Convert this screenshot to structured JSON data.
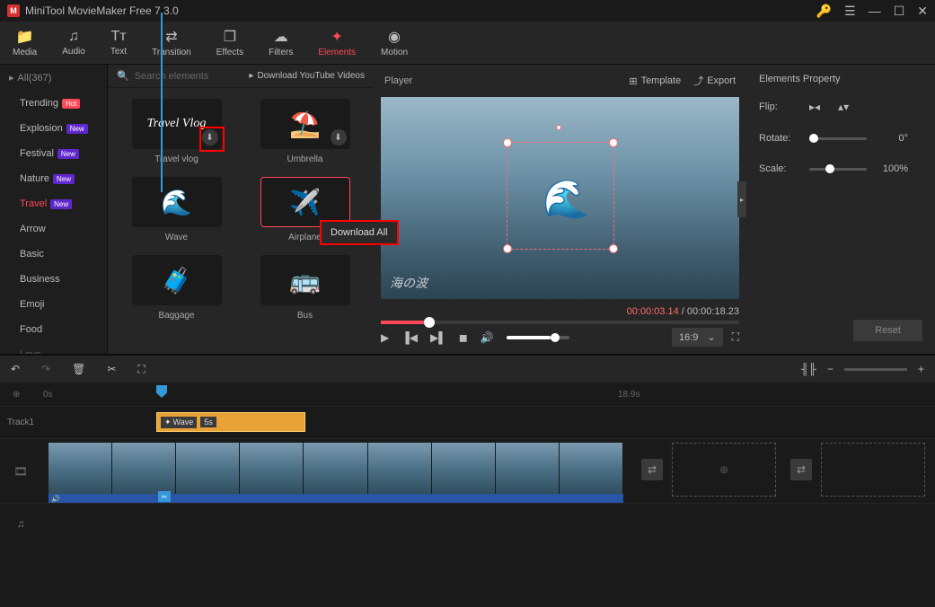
{
  "app": {
    "title": "MiniTool MovieMaker Free 7.3.0"
  },
  "toolbar": {
    "items": [
      {
        "label": "Media",
        "icon": "folder"
      },
      {
        "label": "Audio",
        "icon": "music"
      },
      {
        "label": "Text",
        "icon": "text"
      },
      {
        "label": "Transition",
        "icon": "transition"
      },
      {
        "label": "Effects",
        "icon": "effects"
      },
      {
        "label": "Filters",
        "icon": "filters"
      },
      {
        "label": "Elements",
        "icon": "elements",
        "active": true
      },
      {
        "label": "Motion",
        "icon": "motion"
      }
    ]
  },
  "sidebar": {
    "header": "All(367)",
    "items": [
      {
        "label": "Trending",
        "badge": "Hot",
        "badgeClass": "badge-hot"
      },
      {
        "label": "Explosion",
        "badge": "New",
        "badgeClass": "badge-new"
      },
      {
        "label": "Festival",
        "badge": "New",
        "badgeClass": "badge-new"
      },
      {
        "label": "Nature",
        "badge": "New",
        "badgeClass": "badge-new"
      },
      {
        "label": "Travel",
        "badge": "New",
        "badgeClass": "badge-new",
        "active": true
      },
      {
        "label": "Arrow"
      },
      {
        "label": "Basic"
      },
      {
        "label": "Business"
      },
      {
        "label": "Emoji"
      },
      {
        "label": "Food"
      },
      {
        "label": "Love"
      }
    ]
  },
  "elements": {
    "search_placeholder": "Search elements",
    "download_link": "Download YouTube Videos",
    "context_menu": "Download All",
    "cards": [
      {
        "label": "Travel vlog",
        "emoji": "Travel Vlog",
        "txt": true,
        "hl": true
      },
      {
        "label": "Umbrella",
        "emoji": "⛱️"
      },
      {
        "label": "Wave",
        "emoji": "🌊"
      },
      {
        "label": "Airplane",
        "emoji": "✈️",
        "selected": true
      },
      {
        "label": "Baggage",
        "emoji": "🧳"
      },
      {
        "label": "Bus",
        "emoji": "🚌"
      }
    ]
  },
  "player": {
    "title": "Player",
    "template": "Template",
    "export": "Export",
    "watermark": "海の波",
    "time_current": "00:00:03.14",
    "time_total": "00:00:18.23",
    "aspect": "16:9"
  },
  "props": {
    "title": "Elements Property",
    "flip": "Flip:",
    "rotate": "Rotate:",
    "rotate_val": "0°",
    "scale": "Scale:",
    "scale_val": "100%",
    "reset": "Reset"
  },
  "timeline": {
    "start": "0s",
    "marker": "18.9s",
    "track1": "Track1",
    "clip_name": "Wave",
    "clip_dur": "5s"
  }
}
